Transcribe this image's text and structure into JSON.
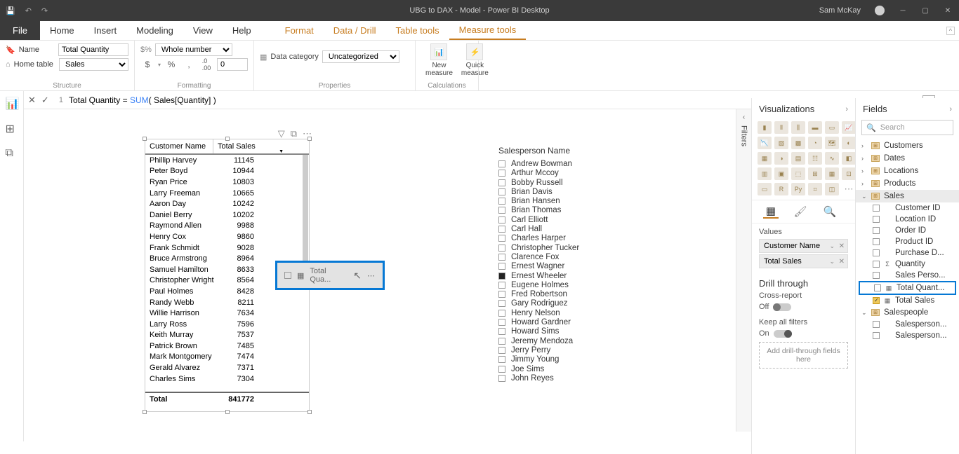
{
  "titlebar": {
    "title": "UBG to DAX - Model - Power BI Desktop",
    "user": "Sam McKay"
  },
  "menu": {
    "file": "File",
    "tabs": [
      "Home",
      "Insert",
      "Modeling",
      "View",
      "Help"
    ],
    "context_tabs": [
      "Format",
      "Data / Drill",
      "Table tools",
      "Measure tools"
    ]
  },
  "ribbon": {
    "structure": {
      "label": "Structure",
      "name_label": "Name",
      "name_value": "Total Quantity",
      "hometable_label": "Home table",
      "hometable_value": "Sales"
    },
    "formatting": {
      "label": "Formatting",
      "format_value": "Whole number",
      "decimals": "0",
      "dollar": "$",
      "percent": "%",
      "comma": ",",
      "dec_icon": ".0"
    },
    "properties": {
      "label": "Properties",
      "datacat_label": "Data category",
      "datacat_value": "Uncategorized"
    },
    "calculations": {
      "label": "Calculations",
      "new_measure": "New measure",
      "quick_measure": "Quick measure"
    }
  },
  "formula": {
    "line_no": "1",
    "pre": "Total Quantity = ",
    "fn": "SUM",
    "rest": "( Sales[Quantity] )"
  },
  "table": {
    "col1": "Customer Name",
    "col2": "Total Sales",
    "rows": [
      {
        "n": "Phillip Harvey",
        "v": "11145"
      },
      {
        "n": "Peter Boyd",
        "v": "10944"
      },
      {
        "n": "Ryan Price",
        "v": "10803"
      },
      {
        "n": "Larry Freeman",
        "v": "10665"
      },
      {
        "n": "Aaron Day",
        "v": "10242"
      },
      {
        "n": "Daniel Berry",
        "v": "10202"
      },
      {
        "n": "Raymond Allen",
        "v": "9988"
      },
      {
        "n": "Henry Cox",
        "v": "9860"
      },
      {
        "n": "Frank Schmidt",
        "v": "9028"
      },
      {
        "n": "Bruce Armstrong",
        "v": "8964"
      },
      {
        "n": "Samuel Hamilton",
        "v": "8633"
      },
      {
        "n": "Christopher Wright",
        "v": "8564"
      },
      {
        "n": "Paul Holmes",
        "v": "8428"
      },
      {
        "n": "Randy Webb",
        "v": "8211"
      },
      {
        "n": "Willie Harrison",
        "v": "7634"
      },
      {
        "n": "Larry Ross",
        "v": "7596"
      },
      {
        "n": "Keith Murray",
        "v": "7537"
      },
      {
        "n": "Patrick Brown",
        "v": "7485"
      },
      {
        "n": "Mark Montgomery",
        "v": "7474"
      },
      {
        "n": "Gerald Alvarez",
        "v": "7371"
      },
      {
        "n": "Charles Sims",
        "v": "7304"
      }
    ],
    "total_label": "Total",
    "total_value": "841772"
  },
  "drag": {
    "label": "Total Qua..."
  },
  "slicer": {
    "title": "Salesperson Name",
    "items": [
      "Andrew Bowman",
      "Arthur Mccoy",
      "Bobby Russell",
      "Brian Davis",
      "Brian Hansen",
      "Brian Thomas",
      "Carl Elliott",
      "Carl Hall",
      "Charles Harper",
      "Christopher Tucker",
      "Clarence Fox",
      "Ernest Wagner",
      "Ernest Wheeler",
      "Eugene Holmes",
      "Fred Robertson",
      "Gary Rodriguez",
      "Henry Nelson",
      "Howard Gardner",
      "Howard Sims",
      "Jeremy Mendoza",
      "Jerry Perry",
      "Jimmy Young",
      "Joe Sims",
      "John Reyes"
    ],
    "selected": "Ernest Wheeler"
  },
  "filters": {
    "label": "Filters"
  },
  "viz": {
    "title": "Visualizations",
    "values_label": "Values",
    "wells": [
      "Customer Name",
      "Total Sales"
    ],
    "drill_label": "Drill through",
    "cross_report": "Cross-report",
    "off": "Off",
    "keep_filters": "Keep all filters",
    "on": "On",
    "drop_hint": "Add drill-through fields here"
  },
  "fields": {
    "title": "Fields",
    "search": "Search",
    "tables": [
      "Customers",
      "Dates",
      "Locations",
      "Products",
      "Sales",
      "Salespeople"
    ],
    "sales_fields": [
      {
        "name": "Customer ID",
        "check": false,
        "sig": ""
      },
      {
        "name": "Location ID",
        "check": false,
        "sig": ""
      },
      {
        "name": "Order ID",
        "check": false,
        "sig": ""
      },
      {
        "name": "Product ID",
        "check": false,
        "sig": ""
      },
      {
        "name": "Purchase D...",
        "check": false,
        "sig": ""
      },
      {
        "name": "Quantity",
        "check": false,
        "sig": "Σ"
      },
      {
        "name": "Sales Perso...",
        "check": false,
        "sig": ""
      },
      {
        "name": "Total Quant...",
        "check": false,
        "sig": "▦",
        "hl": true
      },
      {
        "name": "Total Sales",
        "check": true,
        "sig": "▦"
      }
    ],
    "sp_fields": [
      {
        "name": "Salesperson...",
        "check": false
      },
      {
        "name": "Salesperson...",
        "check": false
      }
    ]
  }
}
